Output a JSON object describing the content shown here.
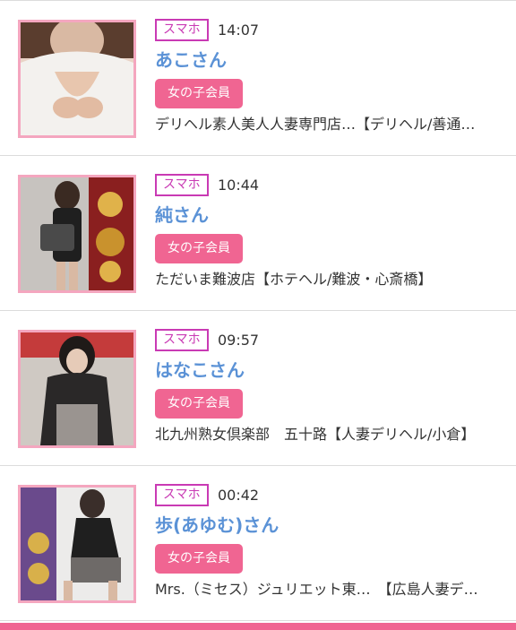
{
  "colors": {
    "accent": "#f06592",
    "device_tag": "#c93ab4",
    "name_link": "#5b92d6",
    "thumb_border": "#f4a6bf"
  },
  "items": [
    {
      "device": "スマホ",
      "time": "14:07",
      "name": "あこさん",
      "badge": "女の子会員",
      "shop": "デリヘル素人美人人妻専門店…【デリヘル/善通…"
    },
    {
      "device": "スマホ",
      "time": "10:44",
      "name": "純さん",
      "badge": "女の子会員",
      "shop": "ただいま難波店【ホテヘル/難波・心斎橋】"
    },
    {
      "device": "スマホ",
      "time": "09:57",
      "name": "はなこさん",
      "badge": "女の子会員",
      "shop": "北九州熟女倶楽部　五十路【人妻デリヘル/小倉】"
    },
    {
      "device": "スマホ",
      "time": "00:42",
      "name": "歩(あゆむ)さん",
      "badge": "女の子会員",
      "shop": "Mrs.（ミセス）ジュリエット東…　【広島人妻デ…"
    }
  ]
}
